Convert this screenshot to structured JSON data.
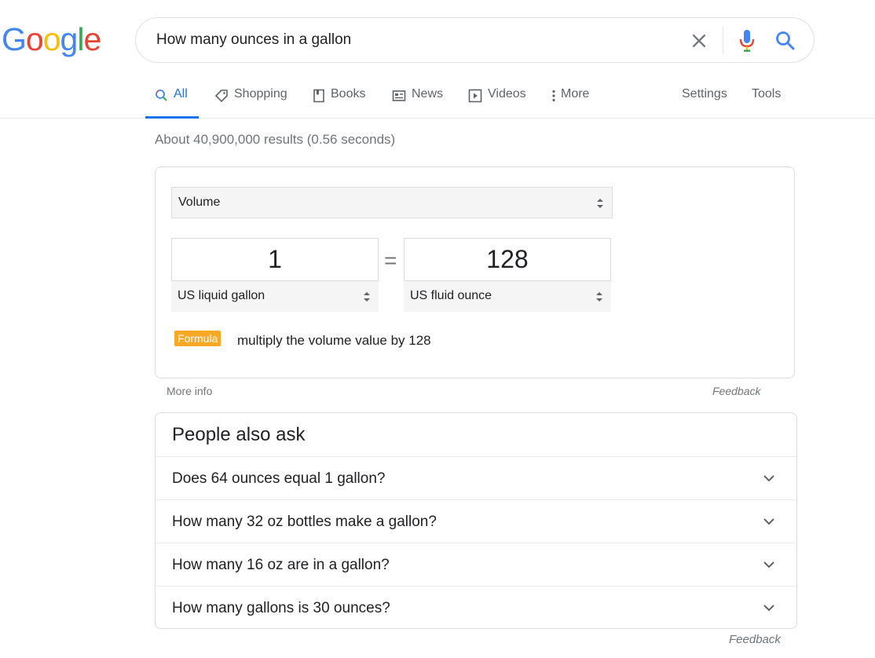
{
  "logo": {
    "letters": [
      {
        "ch": "G",
        "color": "#4285F4"
      },
      {
        "ch": "o",
        "color": "#EA4335"
      },
      {
        "ch": "o",
        "color": "#FBBC05"
      },
      {
        "ch": "g",
        "color": "#4285F4"
      },
      {
        "ch": "l",
        "color": "#34A853"
      },
      {
        "ch": "e",
        "color": "#EA4335"
      }
    ]
  },
  "search": {
    "query": "How many ounces in a gallon",
    "icons": [
      "clear-icon",
      "microphone-icon",
      "search-icon"
    ]
  },
  "tabs": [
    {
      "label": "All",
      "icon": "search-icon",
      "active": true
    },
    {
      "label": "Shopping",
      "icon": "tag-icon"
    },
    {
      "label": "Books",
      "icon": "book-icon"
    },
    {
      "label": "News",
      "icon": "newspaper-icon"
    },
    {
      "label": "Videos",
      "icon": "play-icon"
    },
    {
      "label": "More",
      "icon": "more-vert-icon"
    }
  ],
  "tabs_right": {
    "settings": "Settings",
    "tools": "Tools"
  },
  "stats": "About 40,900,000 results (0.56 seconds)",
  "converter": {
    "category": "Volume",
    "from_value": "1",
    "from_unit": "US liquid gallon",
    "equals": "=",
    "to_value": "128",
    "to_unit": "US fluid ounce",
    "formula_label": "Formula",
    "formula_text": "multiply the volume value by 128"
  },
  "more_info": "More info",
  "feedback": "Feedback",
  "people_also_ask": {
    "title": "People also ask",
    "questions": [
      "Does 64 ounces equal 1 gallon?",
      "How many 32 oz bottles make a gallon?",
      "How many 16 oz are in a gallon?",
      "How many gallons is 30 ounces?"
    ]
  },
  "feedback_bottom": "Feedback",
  "colors": {
    "accent": "#1a73e8",
    "formula_badge": "#f9a825",
    "mic_blue": "#4285F4",
    "mic_red": "#EA4335",
    "mic_yellow": "#FBBC05",
    "mic_green": "#34A853"
  }
}
